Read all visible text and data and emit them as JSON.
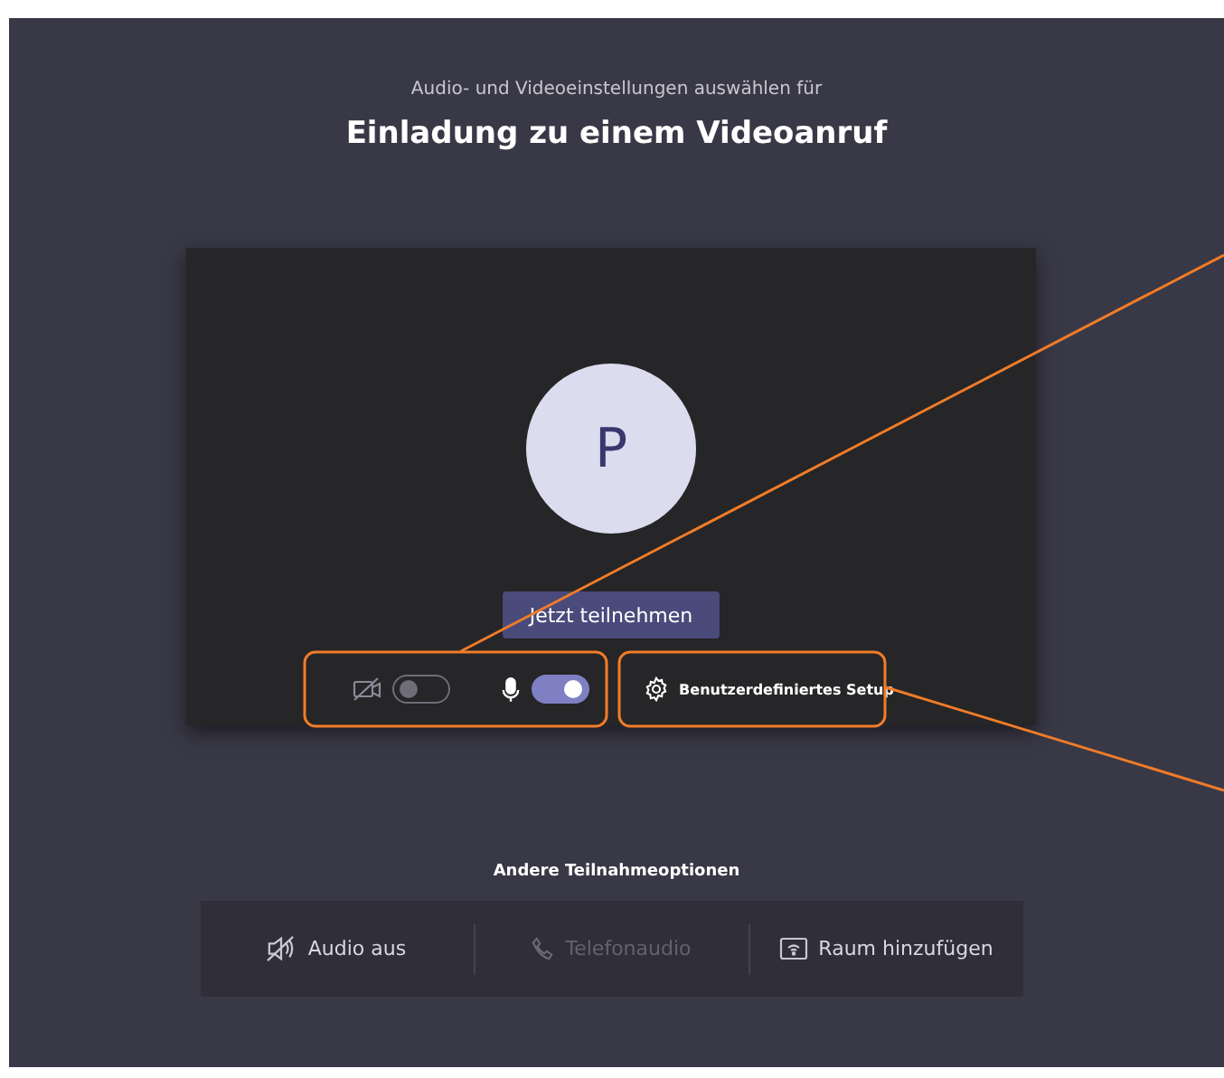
{
  "header": {
    "subtitle": "Audio- und Videoeinstellungen auswählen für",
    "title": "Einladung zu einem Videoanruf"
  },
  "preview": {
    "avatar_initial": "P",
    "join_button": "Jetzt teilnehmen"
  },
  "devices": [
    {
      "kind": "camera",
      "on": false
    },
    {
      "kind": "microphone",
      "on": true
    }
  ],
  "custom_setup": {
    "label": "Benutzerdefiniertes Setup"
  },
  "other_options": {
    "title": "Andere Teilnahmeoptionen",
    "items": [
      {
        "kind": "audio-off",
        "label": "Audio aus",
        "disabled": false
      },
      {
        "kind": "phone",
        "label": "Telefonaudio",
        "disabled": true
      },
      {
        "kind": "room",
        "label": "Raum hinzufügen",
        "disabled": false
      }
    ]
  }
}
